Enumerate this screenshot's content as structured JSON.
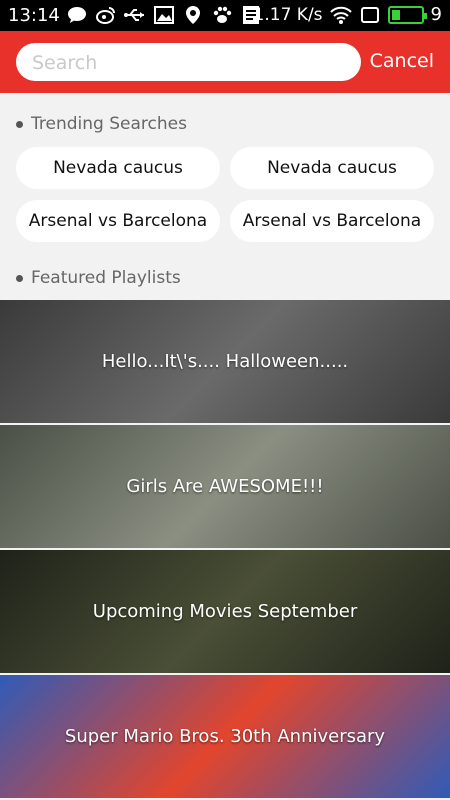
{
  "status_bar": {
    "time": "13:14",
    "speed": "1.17 K/s",
    "battery_level": "9",
    "battery_percent": 9,
    "icons": [
      "chat-bubble-icon",
      "weibo-icon",
      "usb-icon",
      "image-icon",
      "location-icon",
      "paw-icon",
      "note-icon",
      "wifi-icon",
      "sim-icon",
      "battery-icon"
    ]
  },
  "search": {
    "placeholder": "Search",
    "value": "",
    "cancel_label": "Cancel"
  },
  "trending": {
    "title": "Trending Searches",
    "items": [
      "Nevada caucus",
      "Nevada caucus",
      "Arsenal vs Barcelona",
      "Arsenal vs Barcelona"
    ]
  },
  "featured": {
    "title": "Featured Playlists",
    "items": [
      {
        "title": "Hello...It\\'s.... Halloween.....",
        "bg_colors": [
          "#3a3a3a",
          "#6a6a6a"
        ]
      },
      {
        "title": "Girls Are AWESOME!!!",
        "bg_colors": [
          "#4b5046",
          "#8a8f82"
        ]
      },
      {
        "title": "Upcoming Movies September",
        "bg_colors": [
          "#1f2219",
          "#4a4f36"
        ]
      },
      {
        "title": "Super Mario Bros. 30th Anniversary",
        "bg_colors": [
          "#2f5bb8",
          "#e2452d"
        ]
      }
    ]
  },
  "colors": {
    "accent": "#e8312a",
    "background": "#f2f2f2"
  }
}
